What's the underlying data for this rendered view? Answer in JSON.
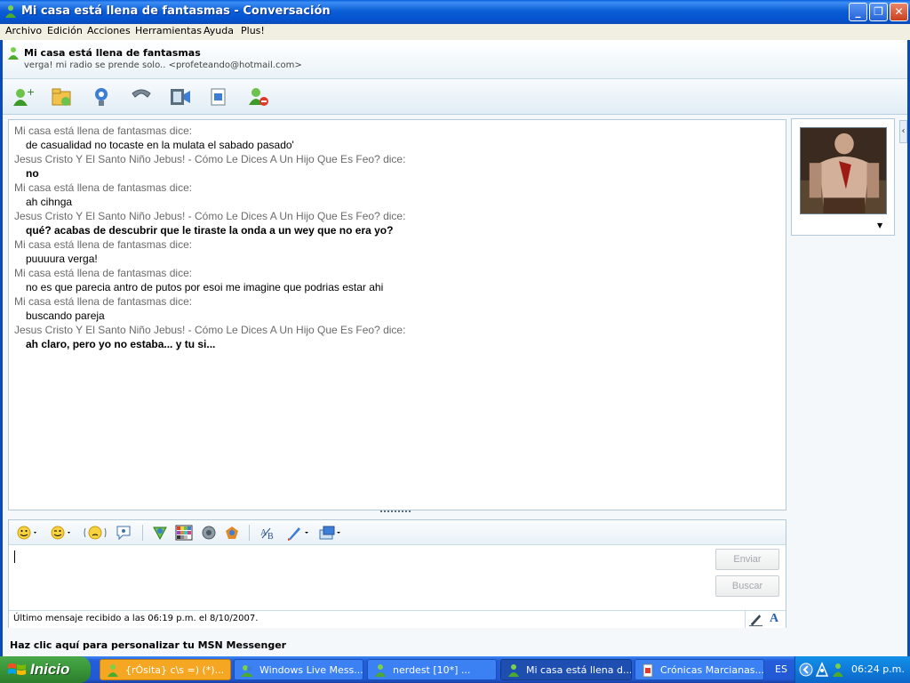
{
  "window": {
    "title": "Mi casa está llena de fantasmas - Conversación"
  },
  "menu": [
    "Archivo",
    "Edición",
    "Acciones",
    "Herramientas",
    "Ayuda",
    "Plus!"
  ],
  "contact": {
    "name": "Mi casa está llena de fantasmas",
    "status": "verga! mi radio se prende solo..  <profeteando@hotmail.com>"
  },
  "toolbar_icons": [
    "invite-contact-icon",
    "send-files-icon",
    "webcam-icon",
    "call-icon",
    "video-icon",
    "activities-icon",
    "block-icon"
  ],
  "messages": [
    {
      "sender": "Mi casa está llena de fantasmas dice:",
      "text": "de casualidad no tocaste en la mulata el sabado pasado'",
      "bold": false
    },
    {
      "sender": "Jesus Cristo Y El Santo Niño Jebus! - Cómo Le Dices A Un Hijo Que Es Feo? dice:",
      "text": "no",
      "bold": true
    },
    {
      "sender": "Mi casa está llena de fantasmas dice:",
      "text": "ah cihnga",
      "bold": false
    },
    {
      "sender": "Jesus Cristo Y El Santo Niño Jebus! - Cómo Le Dices A Un Hijo Que Es Feo? dice:",
      "text": "qué? acabas de descubrir que le tiraste la onda a un wey que no era yo?",
      "bold": true
    },
    {
      "sender": "Mi casa está llena de fantasmas dice:",
      "text": "puuuura verga!",
      "bold": false
    },
    {
      "sender": "Mi casa está llena de fantasmas dice:",
      "text": "no es que parecia antro de putos por esoi me imagine que podrias estar ahi",
      "bold": false
    },
    {
      "sender": "Mi casa está llena de fantasmas dice:",
      "text": "buscando pareja",
      "bold": false
    },
    {
      "sender": "Jesus Cristo Y El Santo Niño Jebus! - Cómo Le Dices A Un Hijo Que Es Feo? dice:",
      "text": "ah claro, pero yo no estaba... y tu si...",
      "bold": true
    }
  ],
  "input": {
    "value": "",
    "send_label": "Enviar",
    "search_label": "Buscar"
  },
  "status_text": "Último mensaje recibido a las 06:19 p.m. el 8/10/2007.",
  "font_glyph": "A",
  "customize_text": "Haz clic aquí para personalizar tu MSN Messenger",
  "taskbar": {
    "start_label": "Inicio",
    "tasks": [
      {
        "label": "{rÓsita} c\\s =) (*)...",
        "state": "flash"
      },
      {
        "label": "Windows Live Mess...",
        "state": "normal"
      },
      {
        "label": "nerdest  [10*]       ...",
        "state": "normal"
      },
      {
        "label": "Mi casa está llena d...",
        "state": "active"
      },
      {
        "label": "Crónicas Marcianas...",
        "state": "normal"
      }
    ],
    "language": "ES",
    "clock": "06:24 p.m."
  },
  "colors": {
    "titlebar": "#0553d0",
    "sender_text": "#6b6b6b",
    "panel_bg": "#f4f8fb",
    "taskbar": "#245edb"
  }
}
